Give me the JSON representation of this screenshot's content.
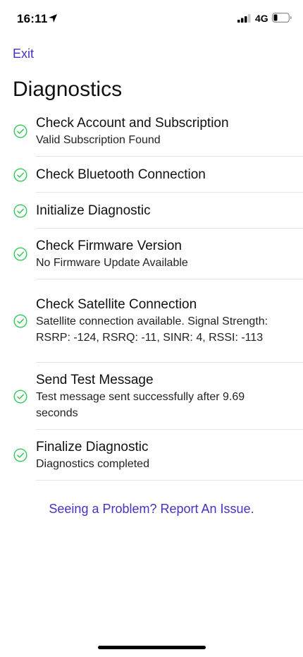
{
  "status_bar": {
    "time": "16:11",
    "network": "4G"
  },
  "nav": {
    "exit_label": "Exit"
  },
  "page_title": "Diagnostics",
  "items": [
    {
      "title": "Check Account and Subscription",
      "subtitle": "Valid Subscription Found"
    },
    {
      "title": "Check Bluetooth Connection",
      "subtitle": ""
    },
    {
      "title": "Initialize Diagnostic",
      "subtitle": ""
    },
    {
      "title": "Check Firmware Version",
      "subtitle": "No Firmware Update Available"
    },
    {
      "title": "Check Satellite Connection",
      "subtitle": "Satellite connection available. Signal Strength: RSRP: -124, RSRQ: -11, SINR: 4, RSSI: -113"
    },
    {
      "title": "Send Test Message",
      "subtitle": "Test message sent successfully after 9.69 seconds"
    },
    {
      "title": "Finalize Diagnostic",
      "subtitle": "Diagnostics completed"
    }
  ],
  "report_link_label": "Seeing a Problem? Report An Issue.",
  "colors": {
    "accent": "#4a2fc4",
    "success": "#34c759"
  },
  "icons": {
    "location": "location-arrow-icon",
    "signal": "cellular-signal-icon",
    "battery": "battery-low-icon",
    "check": "check-circle-icon"
  }
}
